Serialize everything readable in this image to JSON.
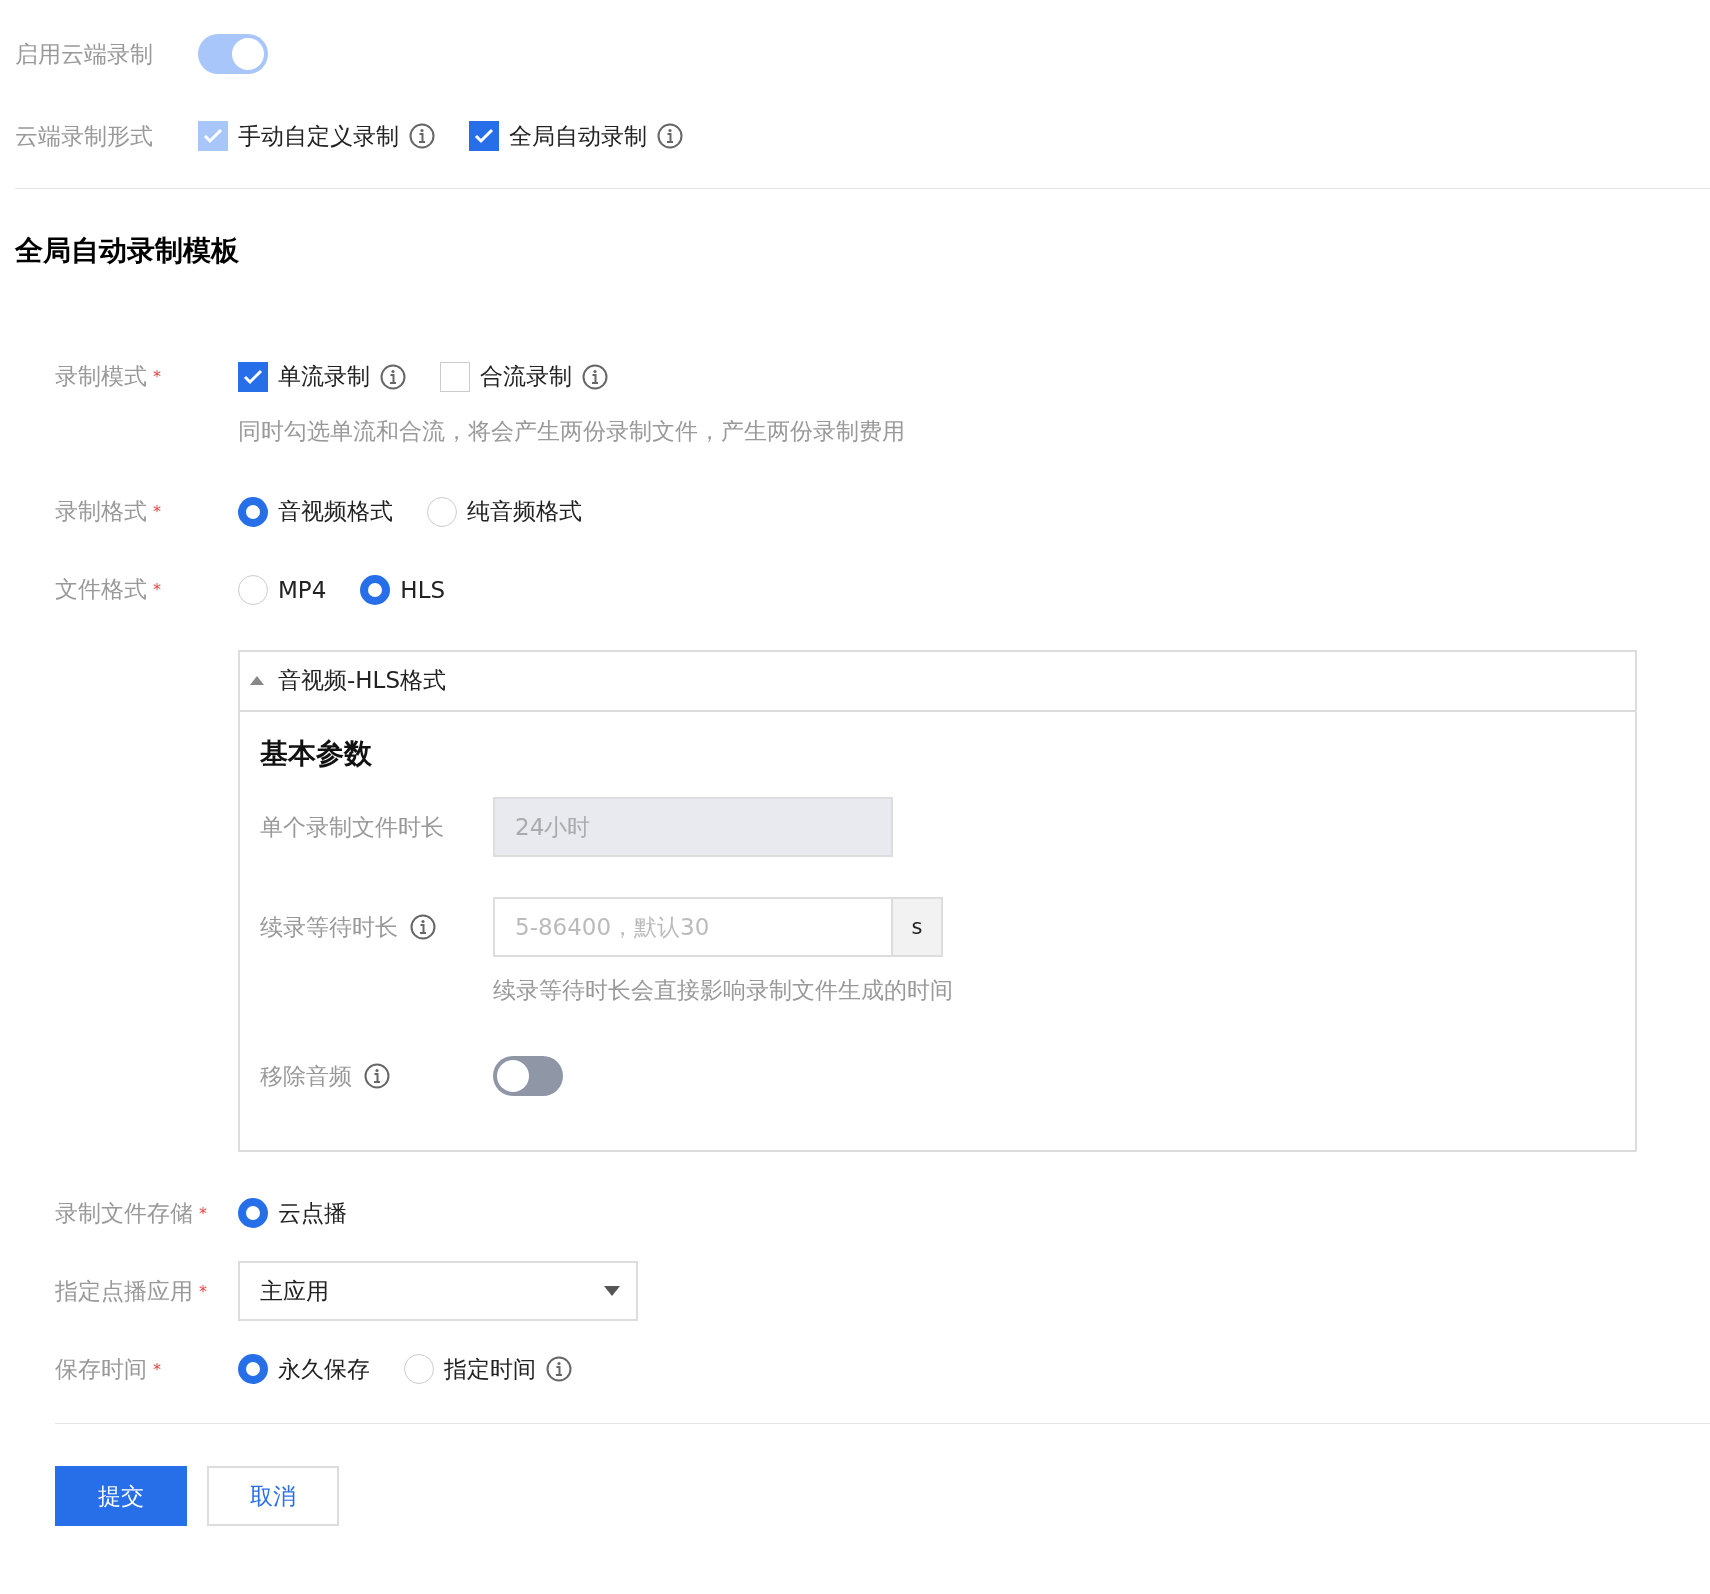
{
  "settings": [
    {
      "kind": "toggle",
      "label": "启用云端录制",
      "on": true,
      "disabled": true
    },
    {
      "kind": "checkboxes",
      "label": "云端录制形式",
      "options": [
        {
          "label": "手动自定义录制",
          "checked": true,
          "disabled": true,
          "info": true
        },
        {
          "label": "全局自动录制",
          "checked": true,
          "disabled": false,
          "info": true
        }
      ]
    }
  ],
  "template": {
    "title": "全局自动录制模板",
    "fields": [
      {
        "kind": "checkboxes",
        "label": "录制模式",
        "required_mark": "*",
        "options": [
          {
            "label": "单流录制",
            "checked": true,
            "disabled": false,
            "info": true
          },
          {
            "label": "合流录制",
            "checked": false,
            "info": true
          }
        ],
        "hint": "同时勾选单流和合流，将会产生两份录制文件，产生两份录制费用"
      },
      {
        "kind": "radios",
        "label": "录制格式",
        "required_mark": "*",
        "options": [
          {
            "label": "音视频格式",
            "selected": true
          },
          {
            "label": "纯音频格式",
            "selected": false
          }
        ]
      },
      {
        "kind": "radios",
        "label": "文件格式",
        "required_mark": "*",
        "options": [
          {
            "label": "MP4",
            "selected": false
          },
          {
            "label": "HLS",
            "selected": true
          }
        ]
      },
      {
        "kind": "panel",
        "title": "音视频-HLS格式",
        "expanded": true,
        "section_title": "基本参数",
        "rows": [
          {
            "kind": "input",
            "label": "单个录制文件时长",
            "value": "24小时",
            "disabled": true
          },
          {
            "kind": "input",
            "label": "续录等待时长",
            "info": true,
            "placeholder": "5-86400，默认30",
            "unit": "s",
            "disabled": false,
            "hint": "续录等待时长会直接影响录制文件生成的时间"
          },
          {
            "kind": "toggle",
            "label": "移除音频",
            "info": true,
            "on": false
          }
        ]
      },
      {
        "kind": "radios",
        "label": "录制文件存储",
        "required_mark": "*",
        "options": [
          {
            "label": "云点播",
            "selected": true
          }
        ]
      },
      {
        "kind": "select",
        "label": "指定点播应用",
        "required_mark": "*",
        "value": "主应用"
      },
      {
        "kind": "radios",
        "label": "保存时间",
        "required_mark": "*",
        "options": [
          {
            "label": "永久保存",
            "selected": true
          },
          {
            "label": "指定时间",
            "selected": false,
            "info": true
          }
        ]
      }
    ]
  },
  "buttons": [
    {
      "label": "提交",
      "kind": "primary"
    },
    {
      "label": "取消",
      "kind": "default"
    }
  ]
}
